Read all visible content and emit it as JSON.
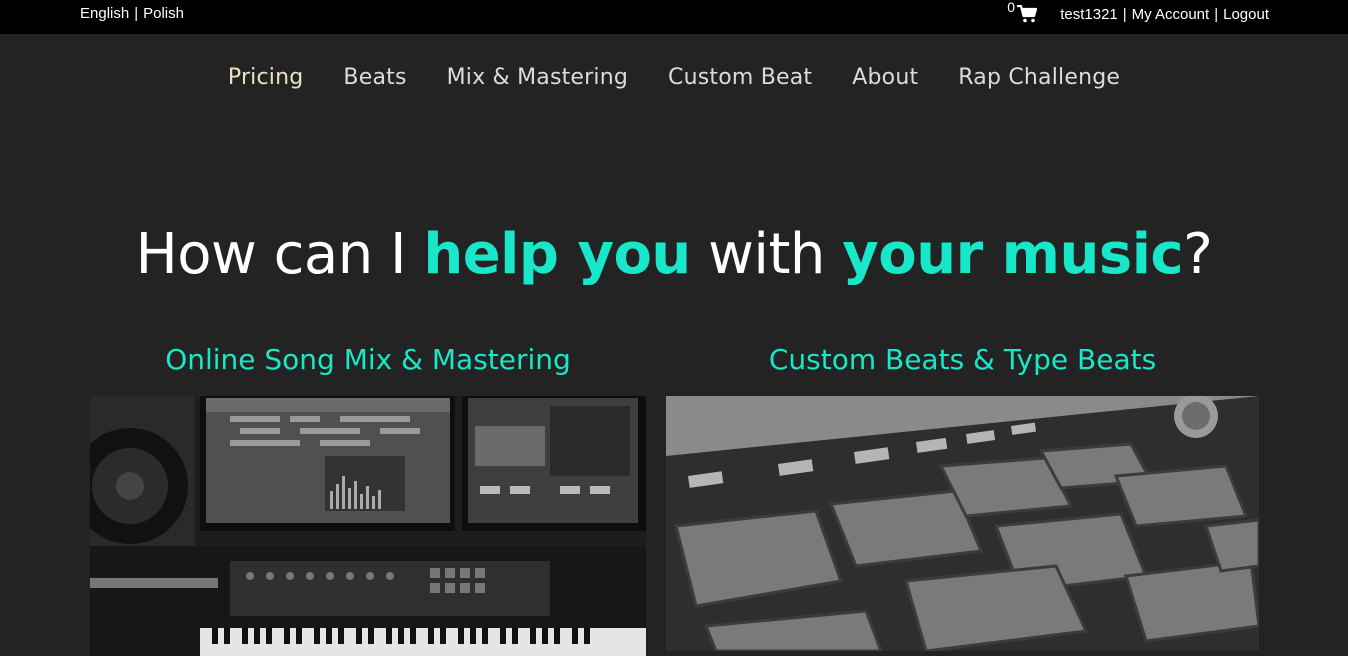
{
  "topbar": {
    "languages": [
      "English",
      "Polish"
    ],
    "separator": "|",
    "cart_count": "0",
    "username": "test1321",
    "my_account": "My Account",
    "logout": "Logout"
  },
  "nav": {
    "items": [
      "Pricing",
      "Beats",
      "Mix & Mastering",
      "Custom Beat",
      "About",
      "Rap Challenge"
    ]
  },
  "hero": {
    "part1": "How can I ",
    "accent1": "help you",
    "part2": " with ",
    "accent2": "your music",
    "part3": "?"
  },
  "cards": [
    {
      "title": "Online Song Mix & Mastering",
      "image": "studio-desk-image"
    },
    {
      "title": "Custom Beats & Type Beats",
      "image": "drum-pad-controller-image"
    }
  ],
  "colors": {
    "accent": "#18e7c9",
    "background": "#232323",
    "topbar": "#000000"
  },
  "icons": {
    "cart": "shopping-cart-icon"
  }
}
